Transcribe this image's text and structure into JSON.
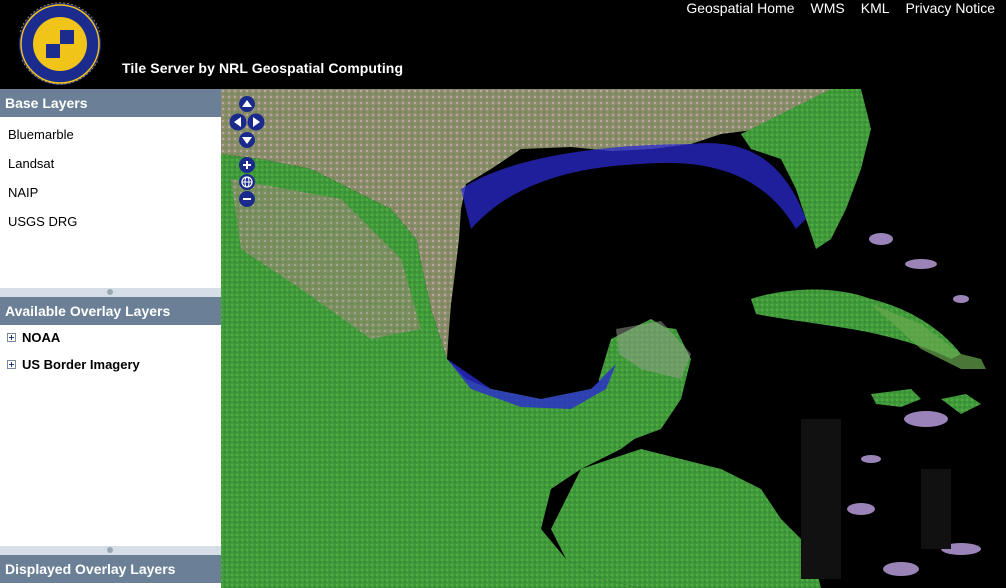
{
  "header": {
    "site_title": "Tile Server by NRL Geospatial Computing",
    "logo": {
      "ring_text_top": "NAVAL RESEARCH LABORATORY",
      "ring_text_bottom": "STENNIS SPACE CENTER, MS",
      "colors": {
        "outer": "#1c2b8e",
        "inner": "#f0c419"
      }
    },
    "links": [
      "Geospatial Home",
      "WMS",
      "KML",
      "Privacy Notice"
    ]
  },
  "sidebar": {
    "base_layers": {
      "title": "Base Layers",
      "items": [
        "Bluemarble",
        "Landsat",
        "NAIP",
        "USGS DRG"
      ]
    },
    "overlay_layers": {
      "title": "Available Overlay Layers",
      "items": [
        "NOAA",
        "US Border Imagery"
      ]
    },
    "displayed_layers": {
      "title": "Displayed Overlay Layers"
    }
  },
  "map": {
    "controls": [
      "pan-up-icon",
      "pan-left-icon",
      "pan-right-icon",
      "pan-down-icon",
      "zoom-in-icon",
      "zoom-world-icon",
      "zoom-out-icon"
    ],
    "colors": {
      "land": "#4a9a3e",
      "land_dry": "#9a8a78",
      "water_shallow": "#2a2ad0",
      "ocean": "#000000"
    }
  }
}
